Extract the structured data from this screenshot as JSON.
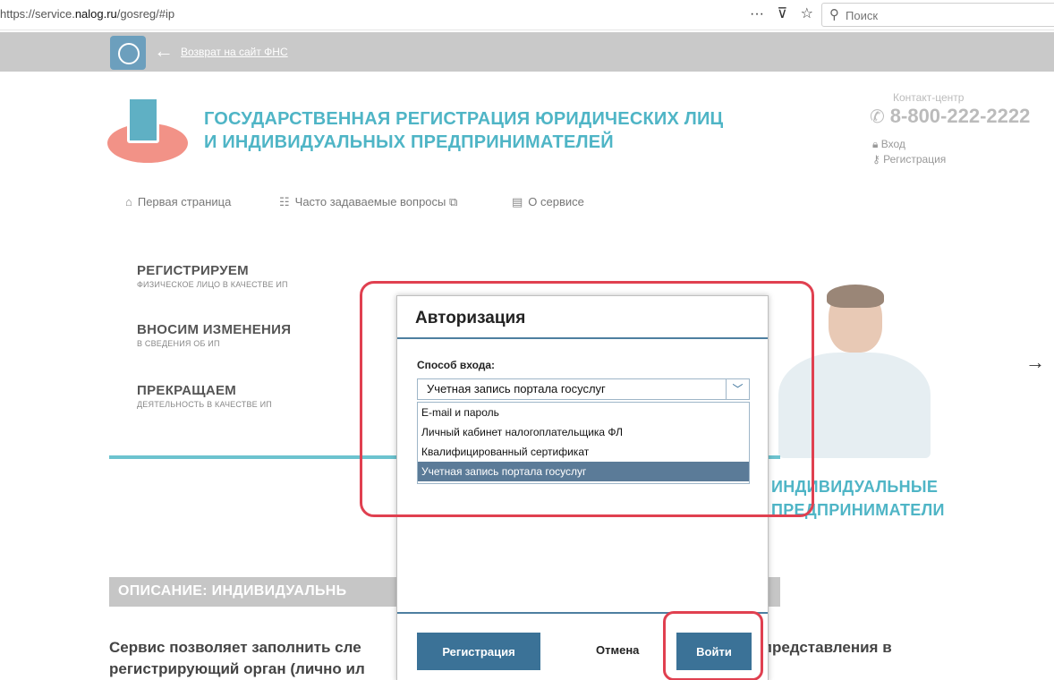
{
  "browser": {
    "url_prefix": "https://service.",
    "url_host": "nalog.ru",
    "url_path": "/gosreg/#ip",
    "search_placeholder": "Поиск"
  },
  "topbar": {
    "back_link": "Возврат на сайт ФНС"
  },
  "header": {
    "title_line1": "ГОСУДАРСТВЕННАЯ РЕГИСТРАЦИЯ ЮРИДИЧЕСКИХ ЛИЦ",
    "title_line2": "И ИНДИВИДУАЛЬНЫХ ПРЕДПРИНИМАТЕЛЕЙ",
    "contact_label": "Контакт-центр",
    "phone": "8-800-222-2222",
    "login": "Вход",
    "register": "Регистрация"
  },
  "nav": {
    "items": [
      {
        "label": "Первая страница",
        "icon": "home-icon"
      },
      {
        "label": "Часто задаваемые вопросы",
        "icon": "faq-icon"
      },
      {
        "label": "О сервисе",
        "icon": "doc-icon"
      }
    ]
  },
  "menu": [
    {
      "title": "РЕГИСТРИРУЕМ",
      "subtitle": "ФИЗИЧЕСКОЕ ЛИЦО В КАЧЕСТВЕ ИП"
    },
    {
      "title": "ВНОСИМ ИЗМЕНЕНИЯ",
      "subtitle": "В СВЕДЕНИЯ ОБ ИП"
    },
    {
      "title": "ПРЕКРАЩАЕМ",
      "subtitle": "ДЕЯТЕЛЬНОСТЬ В КАЧЕСТВЕ ИП"
    }
  ],
  "banner": {
    "ip_line1": "ИНДИВИДУАЛЬНЫЕ",
    "ip_line2": "ПРЕДПРИНИМАТЕЛИ"
  },
  "description": {
    "title": "ОПИСАНИЕ: ИНДИВИДУАЛЬНЬ",
    "text_line1": "Сервис позволяет заполнить сле",
    "text_line1_tail": "представления в",
    "text_line2": "регистрирующий орган (лично ил"
  },
  "modal": {
    "title": "Авторизация",
    "field_label": "Способ входа:",
    "selected": "Учетная запись портала госуслуг",
    "options": [
      "E-mail и пароль",
      "Личный кабинет налогоплательщика ФЛ",
      "Квалифицированный сертификат",
      "Учетная запись портала госуслуг"
    ],
    "selected_index": 3,
    "register_btn": "Регистрация",
    "cancel_btn": "Отмена",
    "login_btn": "Войти"
  },
  "colors": {
    "teal": "#4fb5c6",
    "button_blue": "#3b7297",
    "highlight_red": "#e04050",
    "selected_option": "#5b7b98"
  }
}
